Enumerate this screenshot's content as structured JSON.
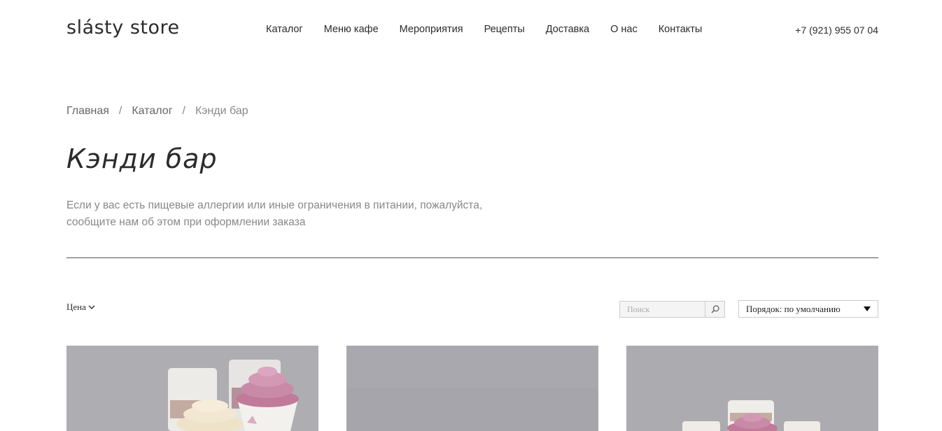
{
  "header": {
    "logo": "slásty store",
    "nav": [
      "Каталог",
      "Меню кафе",
      "Мероприятия",
      "Рецепты",
      "Доставка",
      "О нас",
      "Контакты"
    ],
    "phone": "+7 (921) 955 07 04"
  },
  "breadcrumb": {
    "home": "Главная",
    "catalog": "Каталог",
    "current": "Кэнди бар",
    "separator": "/"
  },
  "page": {
    "title": "Кэнди бар",
    "notice_line1": "Если у вас есть пищевые аллергии или иные ограничения в питании, пожалуйста,",
    "notice_line2": "сообщите нам об этом при оформлении заказа"
  },
  "filters": {
    "price_label": "Цена",
    "search_placeholder": "Поиск",
    "sort_label": "Порядок: по умолчанию"
  },
  "products": [
    {
      "image": "dessert-cups-with-berry-and-cream-swirls"
    },
    {
      "image": "plain-grey-backdrop"
    },
    {
      "image": "dessert-cups-with-berry-cream"
    }
  ],
  "colors": {
    "text": "#2b2b2b",
    "muted": "#888888",
    "divider": "#555555",
    "photo_background": "#a7a6ab"
  }
}
